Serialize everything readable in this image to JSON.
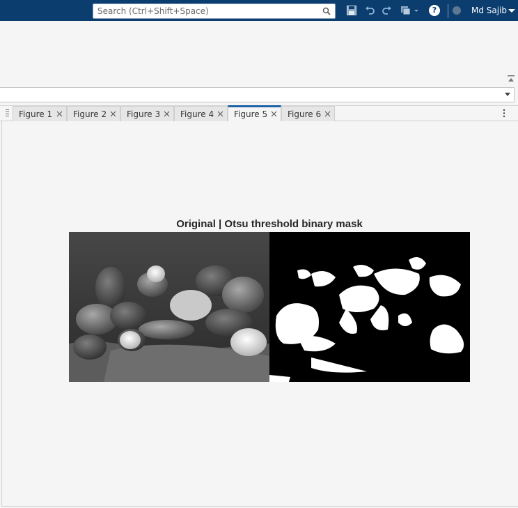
{
  "header": {
    "search_placeholder": "Search (Ctrl+Shift+Space)",
    "user_name": "Md Sajib",
    "icons": [
      "save-icon",
      "undo-icon",
      "redo-icon",
      "switch-windows-icon",
      "help-icon",
      "notification-icon"
    ],
    "colors": {
      "bar": "#0b3d6e",
      "accent": "#1f62a6"
    }
  },
  "tabs": [
    {
      "label": "Figure 1",
      "active": false
    },
    {
      "label": "Figure 2",
      "active": false
    },
    {
      "label": "Figure 3",
      "active": false
    },
    {
      "label": "Figure 4",
      "active": false
    },
    {
      "label": "Figure 5",
      "active": true
    },
    {
      "label": "Figure 6",
      "active": false
    }
  ],
  "figure": {
    "title": "Original | Otsu threshold binary mask"
  }
}
